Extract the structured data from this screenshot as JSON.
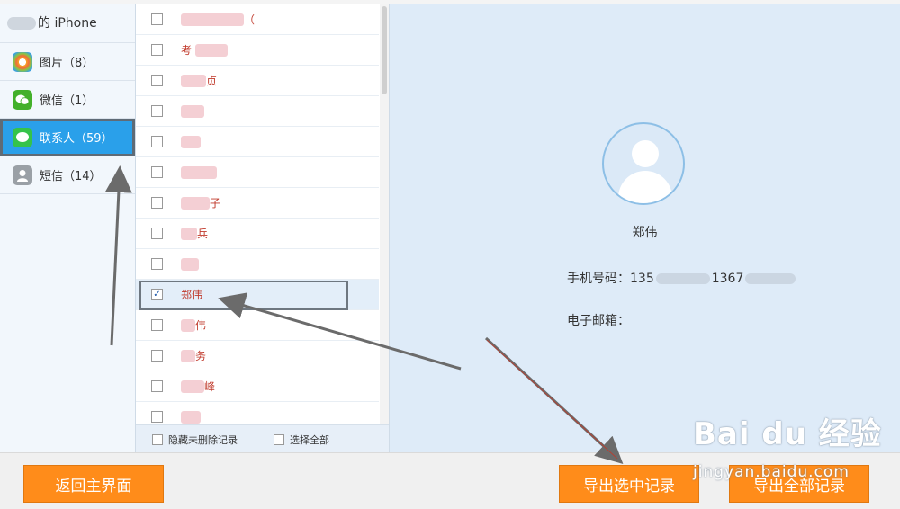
{
  "sidebar": {
    "device_name": "的 iPhone",
    "items": [
      {
        "label": "图片（8）",
        "icon": "photos-icon"
      },
      {
        "label": "微信（1）",
        "icon": "wechat-icon"
      },
      {
        "label": "联系人（59）",
        "icon": "contacts-message-icon",
        "active": true
      },
      {
        "label": "短信（14）",
        "icon": "sms-person-icon"
      }
    ]
  },
  "contacts": {
    "rows": [
      {
        "name": "（",
        "checked": false
      },
      {
        "name": "考",
        "checked": false
      },
      {
        "name": "贞",
        "checked": false
      },
      {
        "name": "",
        "checked": false
      },
      {
        "name": "",
        "checked": false
      },
      {
        "name": "",
        "checked": false
      },
      {
        "name": "子",
        "checked": false
      },
      {
        "name": "兵",
        "checked": false
      },
      {
        "name": "",
        "checked": false
      },
      {
        "name": "郑伟",
        "checked": true,
        "selected": true
      },
      {
        "name": "伟",
        "checked": false
      },
      {
        "name": "务",
        "checked": false
      },
      {
        "name": "峰",
        "checked": false
      },
      {
        "name": "",
        "checked": false
      }
    ],
    "footer": {
      "hide_deleted": "隐藏未删除记录",
      "select_all": "选择全部"
    }
  },
  "detail": {
    "name": "郑伟",
    "phone_label": "手机号码：",
    "phone_part1": "135",
    "phone_part2": "1367",
    "email_label": "电子邮箱："
  },
  "buttons": {
    "home": "返回主界面",
    "export_selected": "导出选中记录",
    "export_all": "导出全部记录"
  },
  "watermark": {
    "brand": "Bai du 经验",
    "url": "jingyan.baidu.com"
  },
  "colors": {
    "accent_orange": "#ff8c1a",
    "active_blue": "#2aa0ea",
    "detail_bg": "#deebf8"
  }
}
